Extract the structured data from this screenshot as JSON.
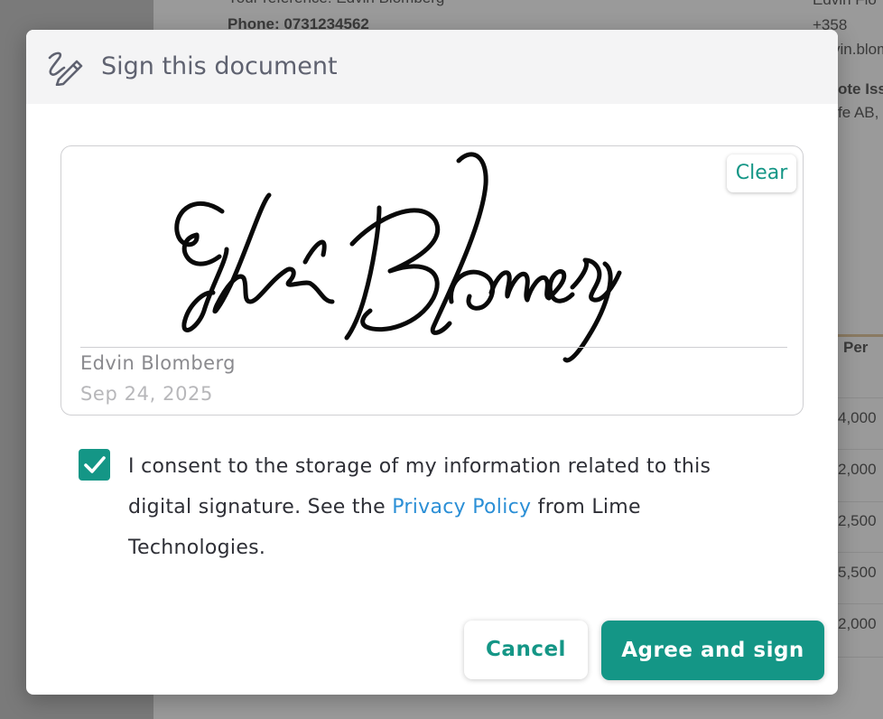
{
  "background_document": {
    "your_reference_line": "Your reference: Edvin Blomberg",
    "phone_line": "Phone: 0731234562",
    "right_name_partial": "Edvin Flo",
    "right_phone_partial": "+358",
    "right_email_partial": "vin.blom",
    "right_heading_partial": "ote Iss",
    "right_company_partial": "fe AB,",
    "column_header_partial": "Per",
    "amounts_partial": [
      "4,000",
      "2,000",
      "2,500",
      "5,500",
      "2,000"
    ]
  },
  "modal": {
    "title": "Sign this document",
    "header_icon": "signature-pen-icon",
    "signature": {
      "clear_label": "Clear",
      "signer_name": "Edvin Blomberg",
      "date": "Sep 24, 2025"
    },
    "consent": {
      "checked": true,
      "text_before_link": "I consent to the storage of my information related to this digital signature. See the ",
      "link_text": "Privacy Policy",
      "text_after_link": " from Lime Technologies."
    },
    "buttons": {
      "cancel_label": "Cancel",
      "agree_label": "Agree and sign"
    }
  },
  "colors": {
    "accent": "#149686",
    "link": "#2b8fd6",
    "overlay": "#7a7a7a",
    "header_bg": "#f4f4f5",
    "title_text": "#5f6270"
  }
}
